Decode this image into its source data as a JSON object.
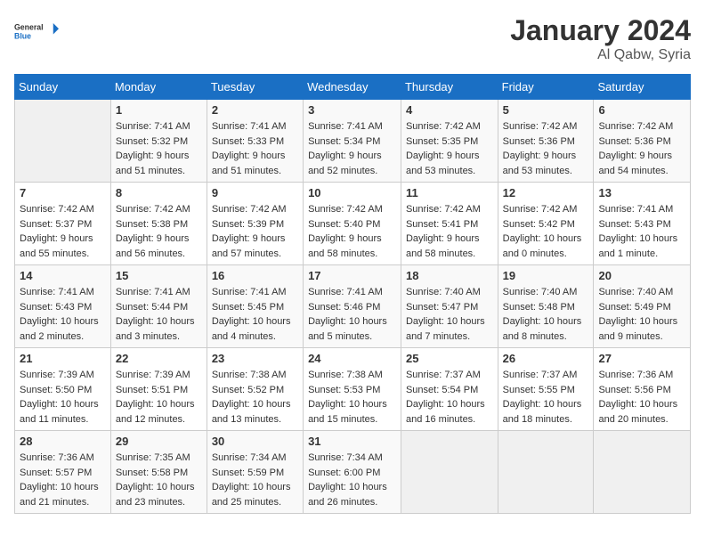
{
  "header": {
    "logo_line1": "General",
    "logo_line2": "Blue",
    "month": "January 2024",
    "location": "Al Qabw, Syria"
  },
  "weekdays": [
    "Sunday",
    "Monday",
    "Tuesday",
    "Wednesday",
    "Thursday",
    "Friday",
    "Saturday"
  ],
  "weeks": [
    [
      {
        "day": "",
        "info": ""
      },
      {
        "day": "1",
        "info": "Sunrise: 7:41 AM\nSunset: 5:32 PM\nDaylight: 9 hours\nand 51 minutes."
      },
      {
        "day": "2",
        "info": "Sunrise: 7:41 AM\nSunset: 5:33 PM\nDaylight: 9 hours\nand 51 minutes."
      },
      {
        "day": "3",
        "info": "Sunrise: 7:41 AM\nSunset: 5:34 PM\nDaylight: 9 hours\nand 52 minutes."
      },
      {
        "day": "4",
        "info": "Sunrise: 7:42 AM\nSunset: 5:35 PM\nDaylight: 9 hours\nand 53 minutes."
      },
      {
        "day": "5",
        "info": "Sunrise: 7:42 AM\nSunset: 5:36 PM\nDaylight: 9 hours\nand 53 minutes."
      },
      {
        "day": "6",
        "info": "Sunrise: 7:42 AM\nSunset: 5:36 PM\nDaylight: 9 hours\nand 54 minutes."
      }
    ],
    [
      {
        "day": "7",
        "info": "Sunrise: 7:42 AM\nSunset: 5:37 PM\nDaylight: 9 hours\nand 55 minutes."
      },
      {
        "day": "8",
        "info": "Sunrise: 7:42 AM\nSunset: 5:38 PM\nDaylight: 9 hours\nand 56 minutes."
      },
      {
        "day": "9",
        "info": "Sunrise: 7:42 AM\nSunset: 5:39 PM\nDaylight: 9 hours\nand 57 minutes."
      },
      {
        "day": "10",
        "info": "Sunrise: 7:42 AM\nSunset: 5:40 PM\nDaylight: 9 hours\nand 58 minutes."
      },
      {
        "day": "11",
        "info": "Sunrise: 7:42 AM\nSunset: 5:41 PM\nDaylight: 9 hours\nand 58 minutes."
      },
      {
        "day": "12",
        "info": "Sunrise: 7:42 AM\nSunset: 5:42 PM\nDaylight: 10 hours\nand 0 minutes."
      },
      {
        "day": "13",
        "info": "Sunrise: 7:41 AM\nSunset: 5:43 PM\nDaylight: 10 hours\nand 1 minute."
      }
    ],
    [
      {
        "day": "14",
        "info": "Sunrise: 7:41 AM\nSunset: 5:43 PM\nDaylight: 10 hours\nand 2 minutes."
      },
      {
        "day": "15",
        "info": "Sunrise: 7:41 AM\nSunset: 5:44 PM\nDaylight: 10 hours\nand 3 minutes."
      },
      {
        "day": "16",
        "info": "Sunrise: 7:41 AM\nSunset: 5:45 PM\nDaylight: 10 hours\nand 4 minutes."
      },
      {
        "day": "17",
        "info": "Sunrise: 7:41 AM\nSunset: 5:46 PM\nDaylight: 10 hours\nand 5 minutes."
      },
      {
        "day": "18",
        "info": "Sunrise: 7:40 AM\nSunset: 5:47 PM\nDaylight: 10 hours\nand 7 minutes."
      },
      {
        "day": "19",
        "info": "Sunrise: 7:40 AM\nSunset: 5:48 PM\nDaylight: 10 hours\nand 8 minutes."
      },
      {
        "day": "20",
        "info": "Sunrise: 7:40 AM\nSunset: 5:49 PM\nDaylight: 10 hours\nand 9 minutes."
      }
    ],
    [
      {
        "day": "21",
        "info": "Sunrise: 7:39 AM\nSunset: 5:50 PM\nDaylight: 10 hours\nand 11 minutes."
      },
      {
        "day": "22",
        "info": "Sunrise: 7:39 AM\nSunset: 5:51 PM\nDaylight: 10 hours\nand 12 minutes."
      },
      {
        "day": "23",
        "info": "Sunrise: 7:38 AM\nSunset: 5:52 PM\nDaylight: 10 hours\nand 13 minutes."
      },
      {
        "day": "24",
        "info": "Sunrise: 7:38 AM\nSunset: 5:53 PM\nDaylight: 10 hours\nand 15 minutes."
      },
      {
        "day": "25",
        "info": "Sunrise: 7:37 AM\nSunset: 5:54 PM\nDaylight: 10 hours\nand 16 minutes."
      },
      {
        "day": "26",
        "info": "Sunrise: 7:37 AM\nSunset: 5:55 PM\nDaylight: 10 hours\nand 18 minutes."
      },
      {
        "day": "27",
        "info": "Sunrise: 7:36 AM\nSunset: 5:56 PM\nDaylight: 10 hours\nand 20 minutes."
      }
    ],
    [
      {
        "day": "28",
        "info": "Sunrise: 7:36 AM\nSunset: 5:57 PM\nDaylight: 10 hours\nand 21 minutes."
      },
      {
        "day": "29",
        "info": "Sunrise: 7:35 AM\nSunset: 5:58 PM\nDaylight: 10 hours\nand 23 minutes."
      },
      {
        "day": "30",
        "info": "Sunrise: 7:34 AM\nSunset: 5:59 PM\nDaylight: 10 hours\nand 25 minutes."
      },
      {
        "day": "31",
        "info": "Sunrise: 7:34 AM\nSunset: 6:00 PM\nDaylight: 10 hours\nand 26 minutes."
      },
      {
        "day": "",
        "info": ""
      },
      {
        "day": "",
        "info": ""
      },
      {
        "day": "",
        "info": ""
      }
    ]
  ]
}
